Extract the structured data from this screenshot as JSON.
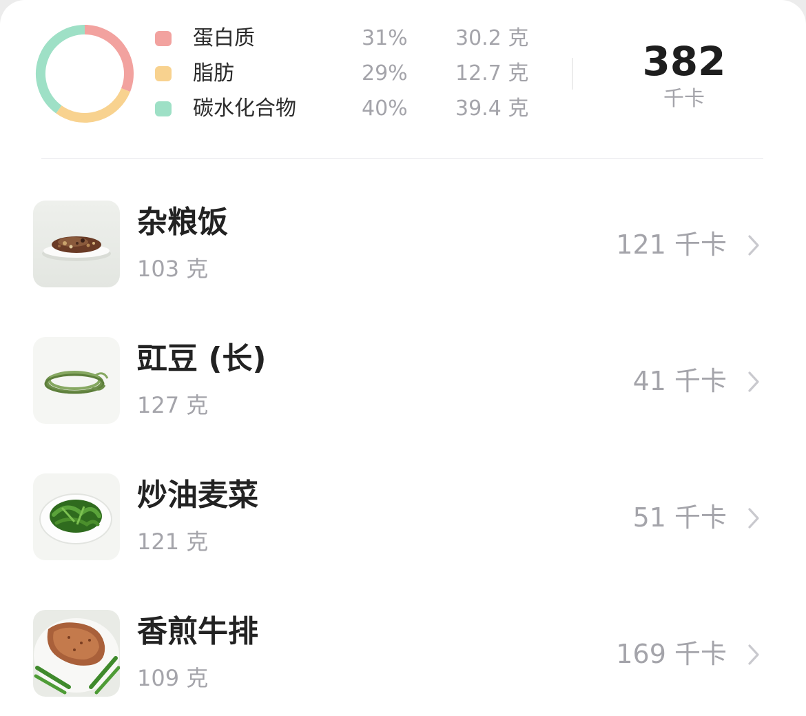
{
  "macros": [
    {
      "name": "蛋白质",
      "percent": "31%",
      "grams": "30.2 克",
      "share": 0.31,
      "color": "#f2a29f"
    },
    {
      "name": "脂肪",
      "percent": "29%",
      "grams": "12.7 克",
      "share": 0.29,
      "color": "#f8d28f"
    },
    {
      "name": "碳水化合物",
      "percent": "40%",
      "grams": "39.4 克",
      "share": 0.4,
      "color": "#9ee0c6"
    }
  ],
  "total": {
    "kcal": "382",
    "unit": "千卡"
  },
  "foods": [
    {
      "name": "杂粮饭",
      "weight": "103 克",
      "kcal": "121 千卡",
      "image": "mixed-grain-rice-photo"
    },
    {
      "name": "豇豆 (长)",
      "weight": "127 克",
      "kcal": "41 千卡",
      "image": "long-beans-photo"
    },
    {
      "name": "炒油麦菜",
      "weight": "121 克",
      "kcal": "51 千卡",
      "image": "stir-fried-lettuce-photo"
    },
    {
      "name": "香煎牛排",
      "weight": "109 克",
      "kcal": "169 千卡",
      "image": "pan-fried-steak-photo"
    }
  ],
  "colors": {
    "text_primary": "#222222",
    "text_secondary": "#a4a4aa",
    "protein": "#f2a29f",
    "fat": "#f8d28f",
    "carbs": "#9ee0c6"
  },
  "icons": {
    "row_chevron": "chevron-right-icon"
  }
}
